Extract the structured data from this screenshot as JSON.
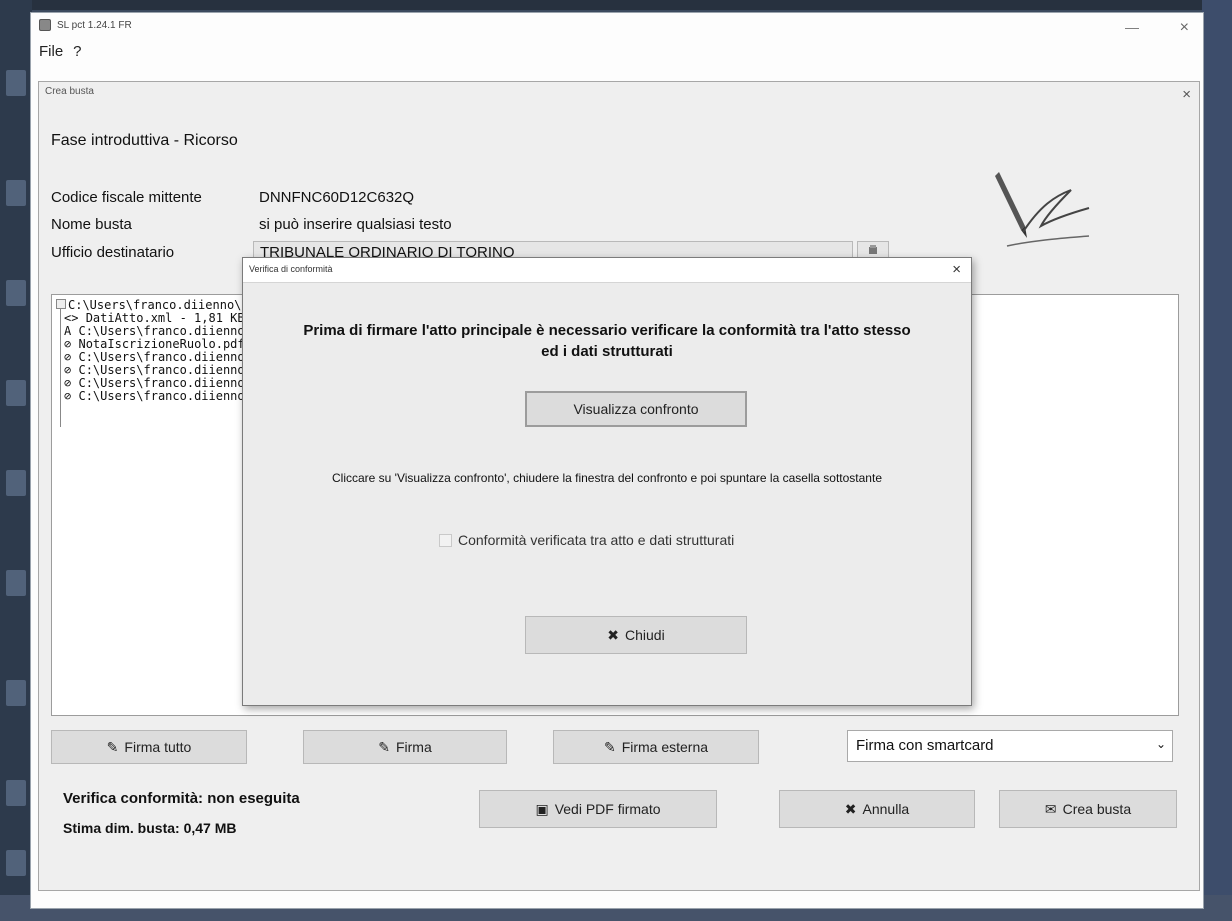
{
  "app": {
    "title": "SL pct 1.24.1 FR",
    "menu": [
      "File",
      "?"
    ],
    "minimize": "—",
    "close": "×"
  },
  "crea_busta": {
    "title": "Crea busta",
    "close": "×",
    "fase": "Fase introduttiva - Ricorso",
    "fields": {
      "codice_label": "Codice fiscale mittente",
      "codice_value": "DNNFNC60D12C632Q",
      "nome_label": "Nome busta",
      "nome_value": "si può inserire qualsiasi testo",
      "ufficio_label": "Ufficio destinatario",
      "ufficio_value": "TRIBUNALE ORDINARIO DI TORINO"
    },
    "tree": [
      {
        "glyph": "",
        "text": "C:\\Users\\franco.diienno\\Do"
      },
      {
        "glyph": "<>",
        "text": "DatiAtto.xml - 1,81 KB"
      },
      {
        "glyph": "A",
        "text": "C:\\Users\\franco.diienno\\"
      },
      {
        "glyph": "paperclip",
        "text": "NotaIscrizioneRuolo.pdf"
      },
      {
        "glyph": "paperclip",
        "text": "C:\\Users\\franco.diienno\\"
      },
      {
        "glyph": "paperclip",
        "text": "C:\\Users\\franco.diienno\\"
      },
      {
        "glyph": "paperclip",
        "text": "C:\\Users\\franco.diienno\\"
      },
      {
        "glyph": "paperclip",
        "text": "C:\\Users\\franco.diienno\\"
      }
    ],
    "buttons": {
      "firma_tutto": "Firma tutto",
      "firma": "Firma",
      "firma_esterna": "Firma esterna",
      "vedi_pdf": "Vedi PDF firmato",
      "annulla": "Annulla",
      "crea": "Crea busta"
    },
    "firma_select": "Firma con smartcard",
    "status_verifica": "Verifica conformità: non eseguita",
    "status_stima": "Stima dim. busta: 0,47 MB"
  },
  "modal": {
    "title": "Verifica di conformità",
    "close": "×",
    "heading": "Prima di firmare l'atto principale è necessario verificare la conformità tra l'atto stesso ed i dati strutturati",
    "visualizza_button": "Visualizza confronto",
    "message": "Cliccare su 'Visualizza confronto', chiudere la finestra del confronto e poi spuntare la casella sottostante",
    "checkbox_label": "Conformità verificata tra atto e dati strutturati",
    "checkbox_checked": false,
    "chiudi_button": "Chiudi"
  }
}
